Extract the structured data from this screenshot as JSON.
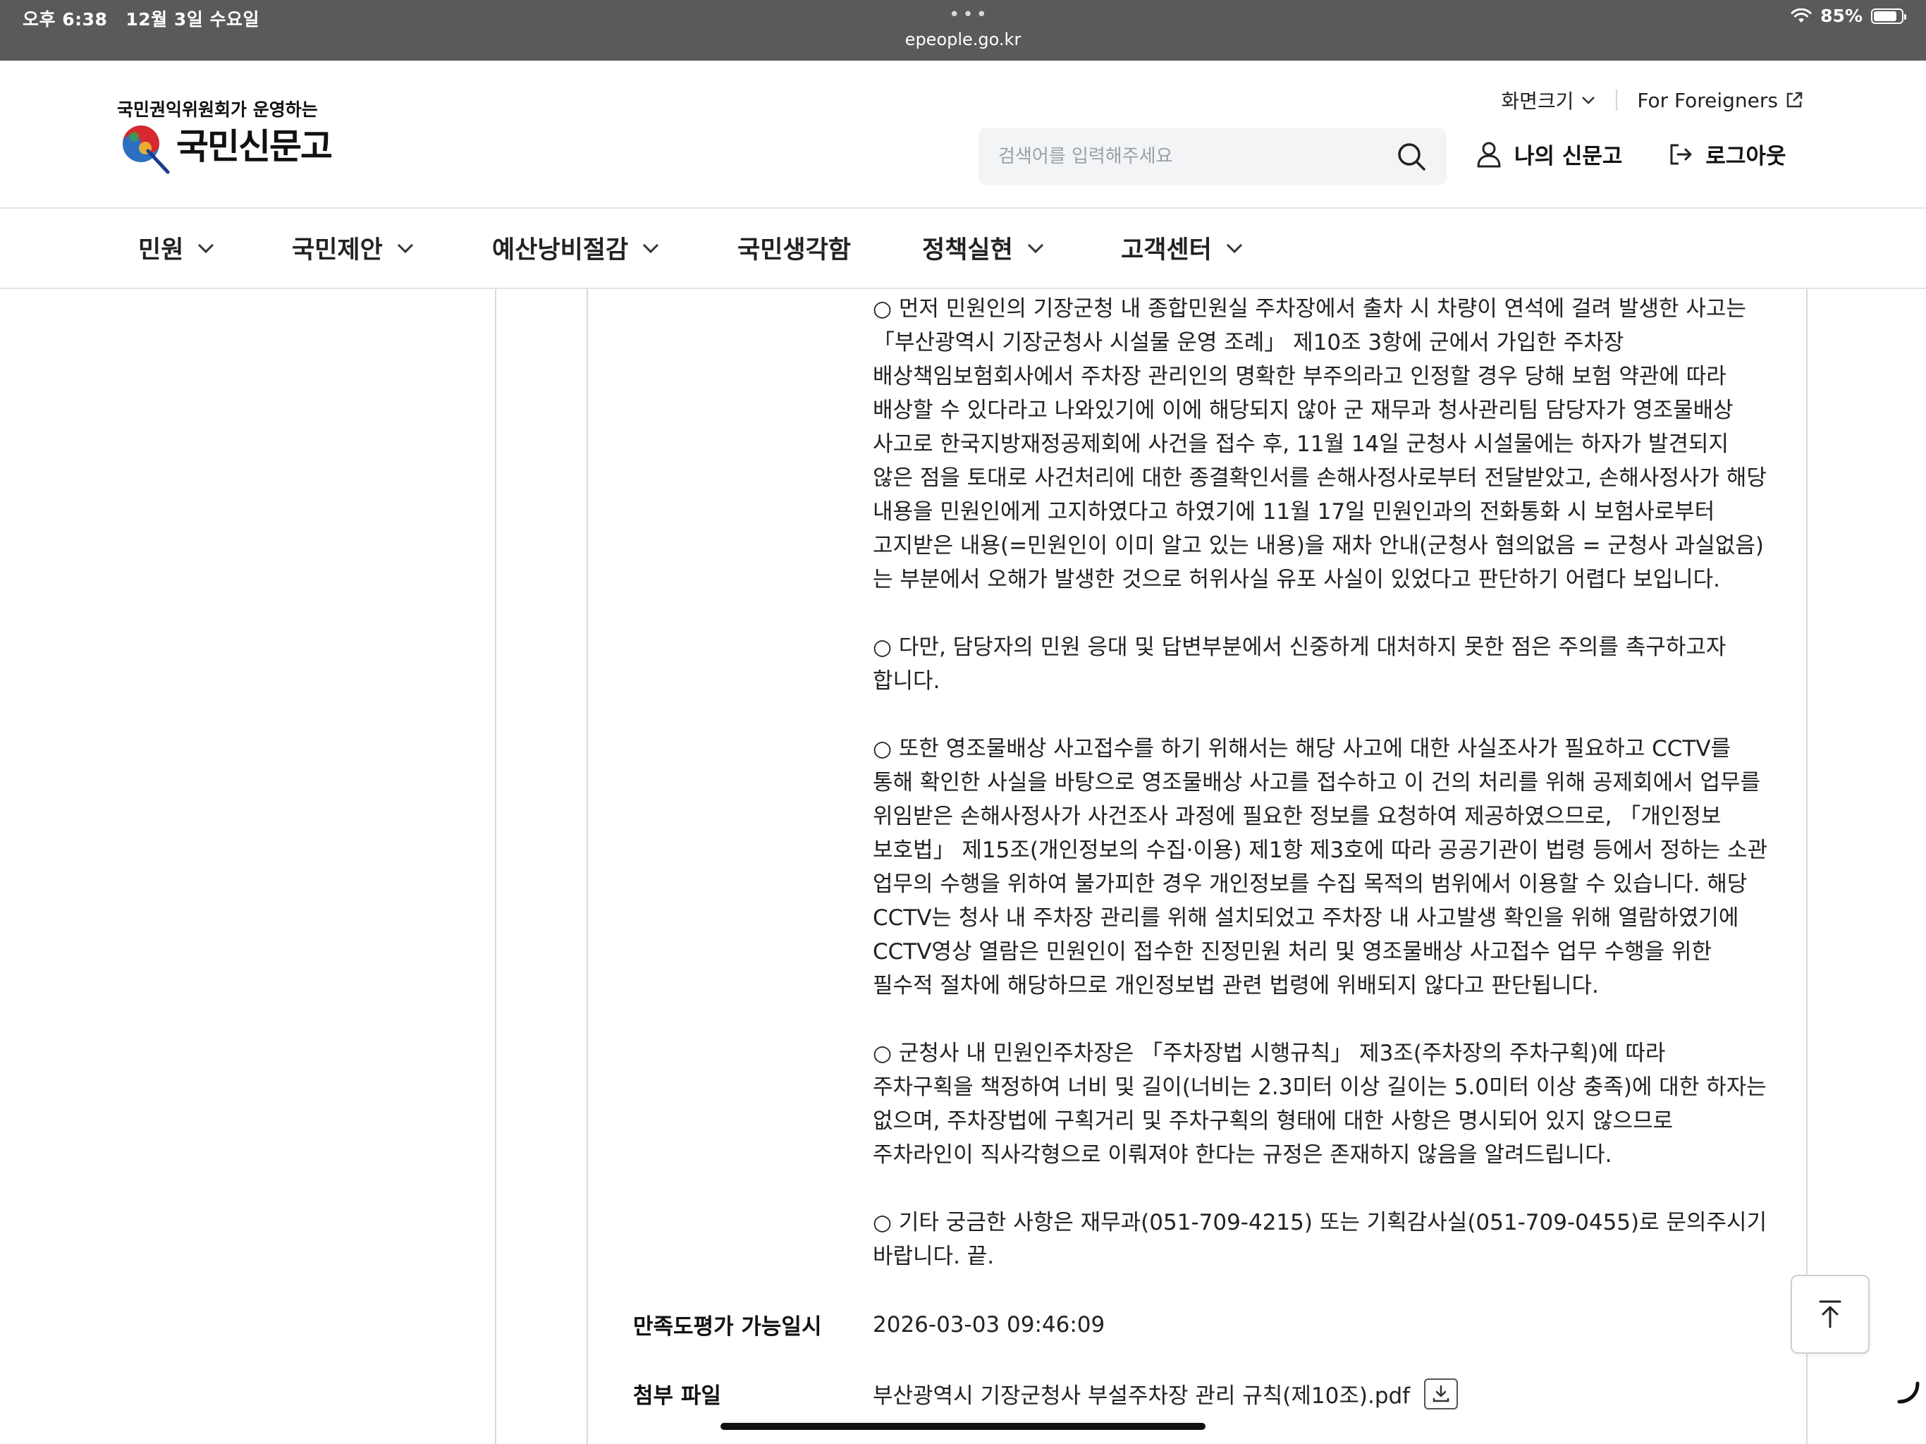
{
  "status_bar": {
    "time": "오후 6:38",
    "date": "12월 3일 수요일",
    "url": "epeople.go.kr",
    "battery": "85%",
    "battery_level": 0.85
  },
  "header": {
    "tagline": "국민권익위원회가 운영하는",
    "logo_text": "국민신문고",
    "screen_size_label": "화면크기",
    "foreigners_label": "For Foreigners",
    "search_placeholder": "검색어를 입력해주세요",
    "my_petition_label": "나의 신문고",
    "logout_label": "로그아웃"
  },
  "nav": {
    "items": [
      {
        "label": "민원",
        "dropdown": true
      },
      {
        "label": "국민제안",
        "dropdown": true
      },
      {
        "label": "예산낭비절감",
        "dropdown": true
      },
      {
        "label": "국민생각함",
        "dropdown": false
      },
      {
        "label": "정책실현",
        "dropdown": true
      },
      {
        "label": "고객센터",
        "dropdown": true
      }
    ]
  },
  "answer": {
    "paragraphs": [
      "○ 먼저 민원인의 기장군청 내 종합민원실 주차장에서 출차 시 차량이 연석에 걸려 발생한 사고는 「부산광역시 기장군청사 시설물 운영 조례」 제10조 3항에 군에서 가입한 주차장 배상책임보험회사에서 주차장 관리인의 명확한 부주의라고 인정할 경우 당해 보험 약관에 따라 배상할 수 있다라고 나와있기에 이에 해당되지 않아 군 재무과 청사관리팀 담당자가 영조물배상 사고로 한국지방재정공제회에 사건을 접수 후, 11월 14일 군청사 시설물에는 하자가 발견되지 않은 점을 토대로 사건처리에 대한 종결확인서를 손해사정사로부터 전달받았고, 손해사정사가 해당 내용을 민원인에게 고지하였다고 하였기에 11월 17일 민원인과의 전화통화 시 보험사로부터 고지받은 내용(=민원인이 이미 알고 있는 내용)을 재차 안내(군청사 혐의없음 = 군청사 과실없음)는 부분에서 오해가 발생한 것으로 허위사실 유포 사실이 있었다고 판단하기 어렵다 보입니다.",
      "○ 다만, 담당자의 민원 응대 및 답변부분에서 신중하게 대처하지 못한 점은 주의를 촉구하고자 합니다.",
      "○ 또한 영조물배상 사고접수를 하기 위해서는 해당 사고에 대한 사실조사가 필요하고 CCTV를 통해 확인한 사실을 바탕으로 영조물배상 사고를 접수하고 이 건의 처리를 위해 공제회에서 업무를 위임받은 손해사정사가 사건조사 과정에 필요한 정보를 요청하여 제공하였으므로, 「개인정보 보호법」 제15조(개인정보의 수집·이용) 제1항 제3호에 따라 공공기관이 법령 등에서 정하는 소관 업무의 수행을 위하여 불가피한 경우 개인정보를 수집 목적의 범위에서 이용할 수 있습니다. 해당 CCTV는 청사 내 주차장 관리를 위해 설치되었고 주차장 내 사고발생 확인을 위해 열람하였기에 CCTV영상 열람은 민원인이 접수한 진정민원 처리 및 영조물배상 사고접수 업무 수행을 위한 필수적 절차에 해당하므로 개인정보법 관련 법령에 위배되지 않다고 판단됩니다.",
      "○ 군청사 내 민원인주차장은 「주차장법 시행규칙」 제3조(주차장의 주차구획)에 따라 주차구획을 책정하여 너비 및 길이(너비는 2.3미터 이상 길이는 5.0미터 이상 충족)에 대한 하자는 없으며, 주차장법에 구획거리 및 주차구획의 형태에 대한 사항은 명시되어 있지 않으므로 주차라인이 직사각형으로 이뤄져야 한다는 규정은 존재하지 않음을 알려드립니다.",
      "○ 기타 궁금한 사항은 재무과(051-709-4215) 또는 기획감사실(051-709-0455)로 문의주시기 바랍니다.  끝."
    ]
  },
  "meta": {
    "satisfaction_label": "만족도평가 가능일시",
    "satisfaction_value": "2026-03-03 09:46:09",
    "attachment_label": "첨부 파일",
    "attachment_value": "부산광역시 기장군청사 부설주차장 관리 규칙(제10조).pdf"
  },
  "icons": {
    "search": "search-icon",
    "user": "user-icon",
    "logout": "logout-icon",
    "external": "external-link-icon",
    "download": "download-icon",
    "top": "arrow-up-to-top-icon"
  }
}
